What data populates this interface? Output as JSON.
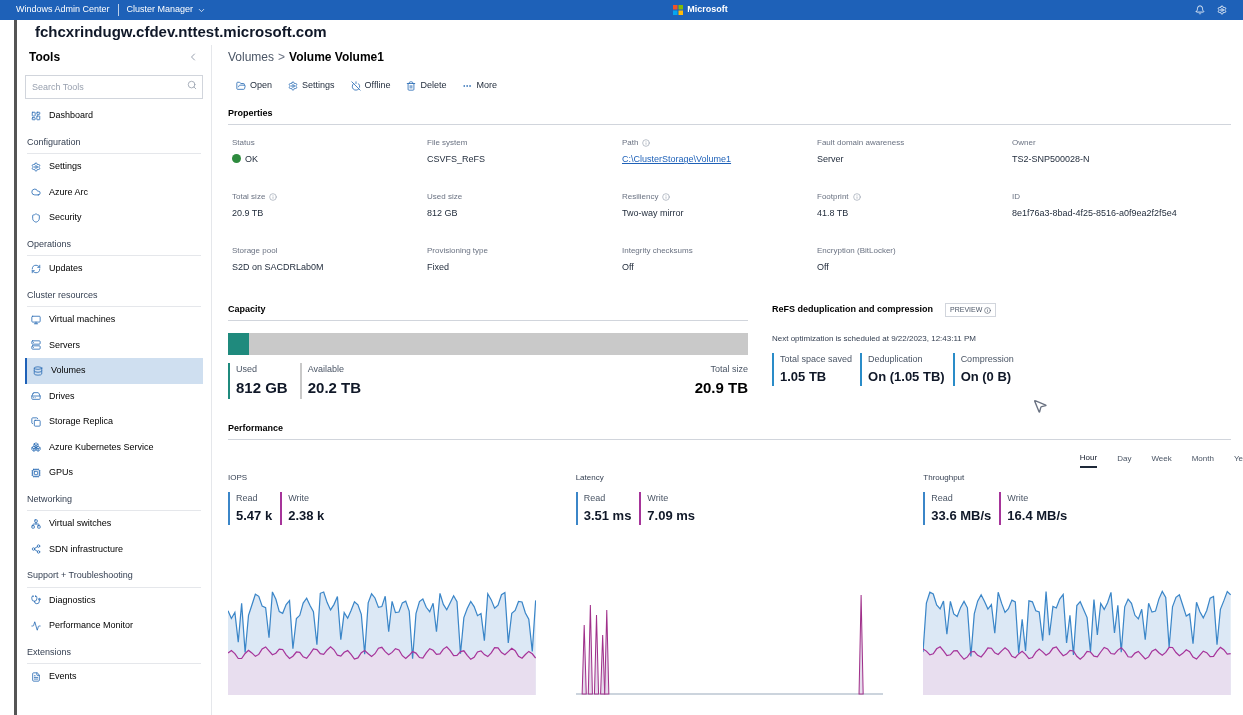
{
  "top_bar": {
    "app": "Windows Admin Center",
    "context": "Cluster Manager",
    "brand": "Microsoft"
  },
  "host": "fchcxrindugw.cfdev.nttest.microsoft.com",
  "sidebar": {
    "title": "Tools",
    "search_placeholder": "Search Tools",
    "items": [
      {
        "kind": "item",
        "label": "Dashboard",
        "selected": false
      },
      {
        "kind": "section",
        "label": "Configuration"
      },
      {
        "kind": "item",
        "label": "Settings",
        "selected": false
      },
      {
        "kind": "item",
        "label": "Azure Arc",
        "selected": false
      },
      {
        "kind": "item",
        "label": "Security",
        "selected": false
      },
      {
        "kind": "section",
        "label": "Operations"
      },
      {
        "kind": "item",
        "label": "Updates",
        "selected": false
      },
      {
        "kind": "section",
        "label": "Cluster resources"
      },
      {
        "kind": "item",
        "label": "Virtual machines",
        "selected": false
      },
      {
        "kind": "item",
        "label": "Servers",
        "selected": false
      },
      {
        "kind": "item",
        "label": "Volumes",
        "selected": true
      },
      {
        "kind": "item",
        "label": "Drives",
        "selected": false
      },
      {
        "kind": "item",
        "label": "Storage Replica",
        "selected": false
      },
      {
        "kind": "item",
        "label": "Azure Kubernetes Service",
        "selected": false
      },
      {
        "kind": "item",
        "label": "GPUs",
        "selected": false
      },
      {
        "kind": "section",
        "label": "Networking"
      },
      {
        "kind": "item",
        "label": "Virtual switches",
        "selected": false
      },
      {
        "kind": "item",
        "label": "SDN infrastructure",
        "selected": false
      },
      {
        "kind": "section",
        "label": "Support + Troubleshooting"
      },
      {
        "kind": "item",
        "label": "Diagnostics",
        "selected": false
      },
      {
        "kind": "item",
        "label": "Performance Monitor",
        "selected": false
      },
      {
        "kind": "section",
        "label": "Extensions"
      },
      {
        "kind": "item",
        "label": "Events",
        "selected": false
      }
    ]
  },
  "breadcrumb": {
    "parent": "Volumes",
    "separator": ">",
    "current": "Volume Volume1"
  },
  "toolbar": [
    {
      "kind": "open",
      "label": "Open"
    },
    {
      "kind": "settings",
      "label": "Settings"
    },
    {
      "kind": "offline",
      "label": "Offline"
    },
    {
      "kind": "delete",
      "label": "Delete"
    },
    {
      "kind": "more",
      "label": "More"
    }
  ],
  "properties": {
    "title": "Properties",
    "rows": [
      [
        {
          "kind": "status",
          "label": "Status",
          "value": "OK",
          "info": false
        },
        {
          "kind": "text",
          "label": "File system",
          "value": "CSVFS_ReFS",
          "info": false
        },
        {
          "kind": "link",
          "label": "Path",
          "value": "C:\\ClusterStorage\\Volume1",
          "info": true
        },
        {
          "kind": "text",
          "label": "Fault domain awareness",
          "value": "Server",
          "info": false
        },
        {
          "kind": "text",
          "label": "Owner",
          "value": "TS2-SNP500028-N",
          "info": false
        }
      ],
      [
        {
          "kind": "text",
          "label": "Total size",
          "value": "20.9 TB",
          "info": true
        },
        {
          "kind": "text",
          "label": "Used size",
          "value": "812 GB",
          "info": false
        },
        {
          "kind": "text",
          "label": "Resiliency",
          "value": "Two-way mirror",
          "info": true
        },
        {
          "kind": "text",
          "label": "Footprint",
          "value": "41.8 TB",
          "info": true
        },
        {
          "kind": "text",
          "label": "ID",
          "value": "8e1f76a3-8bad-4f25-8516-a0f9ea2f2f5e4",
          "info": false
        }
      ],
      [
        {
          "kind": "text",
          "label": "Storage pool",
          "value": "S2D on SACDRLab0M",
          "info": false
        },
        {
          "kind": "text",
          "label": "Provisioning type",
          "value": "Fixed",
          "info": false
        },
        {
          "kind": "text",
          "label": "Integrity checksums",
          "value": "Off",
          "info": false
        },
        {
          "kind": "text",
          "label": "Encryption (BitLocker)",
          "value": "Off",
          "info": false
        }
      ]
    ]
  },
  "capacity": {
    "title": "Capacity",
    "level": 0.04,
    "stats": [
      {
        "kind": "used",
        "label": "Used",
        "value": "812 GB"
      },
      {
        "kind": "available",
        "label": "Available",
        "value": "20.2 TB"
      },
      {
        "kind": "total",
        "label": "Total size",
        "value": "20.9 TB"
      }
    ]
  },
  "dedup": {
    "title": "ReFS deduplication and compression",
    "badge": "PREVIEW",
    "schedule": "Next optimization is scheduled at 9/22/2023, 12:43:11 PM",
    "stats": [
      {
        "label": "Total space saved",
        "value": "1.05 TB"
      },
      {
        "label": "Deduplication",
        "value": "On (1.05 TB)"
      },
      {
        "label": "Compression",
        "value": "On (0 B)"
      }
    ]
  },
  "performance": {
    "title": "Performance",
    "ranges": [
      {
        "label": "Hour",
        "selected": true
      },
      {
        "label": "Day",
        "selected": false
      },
      {
        "label": "Week",
        "selected": false
      },
      {
        "label": "Month",
        "selected": false
      },
      {
        "label": "Ye",
        "selected": false
      }
    ],
    "charts": [
      {
        "kind": "iops",
        "title": "IOPS",
        "read": {
          "label": "Read",
          "value": "5.47 k"
        },
        "write": {
          "label": "Write",
          "value": "2.38 k"
        }
      },
      {
        "kind": "latency",
        "title": "Latency",
        "read": {
          "label": "Read",
          "value": "3.51 ms"
        },
        "write": {
          "label": "Write",
          "value": "7.09 ms"
        }
      },
      {
        "kind": "throughput",
        "title": "Throughput",
        "read": {
          "label": "Read",
          "value": "33.6 MB/s"
        },
        "write": {
          "label": "Write",
          "value": "16.4 MB/s"
        }
      }
    ]
  }
}
